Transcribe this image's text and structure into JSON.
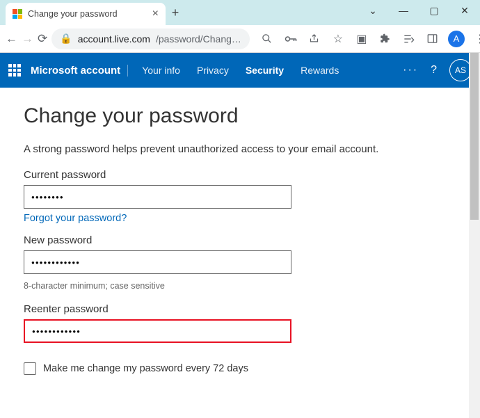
{
  "browser": {
    "tab_title": "Change your password",
    "url_host": "account.live.com",
    "url_path": "/password/Chang…",
    "avatar_letter": "A"
  },
  "header": {
    "brand": "Microsoft account",
    "nav": {
      "your_info": "Your info",
      "privacy": "Privacy",
      "security": "Security",
      "rewards": "Rewards"
    },
    "avatar_initials": "AS"
  },
  "page": {
    "title": "Change your password",
    "helper": "A strong password helps prevent unauthorized access to your email account.",
    "current_label": "Current password",
    "current_value": "●●●●●●●●",
    "forgot_link": "Forgot your password?",
    "new_label": "New password",
    "new_value": "●●●●●●●●●●●●",
    "new_hint": "8-character minimum; case sensitive",
    "reenter_label": "Reenter password",
    "reenter_value": "●●●●●●●●●●●●",
    "checkbox_label": "Make me change my password every 72 days"
  }
}
